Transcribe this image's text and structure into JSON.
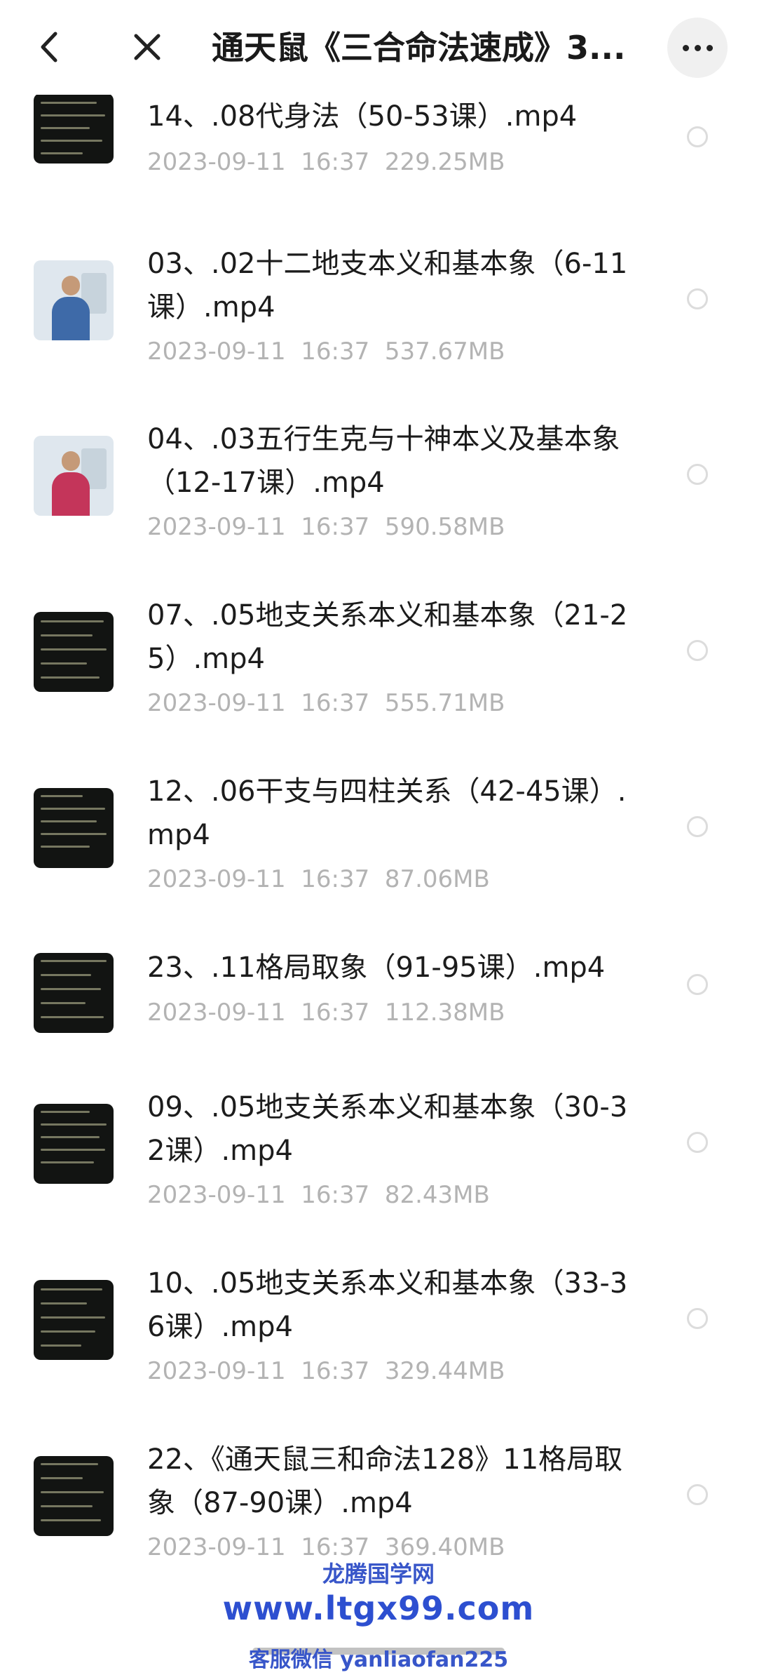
{
  "header": {
    "title": "通天鼠《三合命法速成》3...",
    "back_icon": "chevron-left-icon",
    "close_icon": "close-icon",
    "more_icon": "more-horizontal-icon"
  },
  "files": [
    {
      "name": "14、.08代身法（50-53课）.mp4",
      "date": "2023-09-11",
      "time": "16:37",
      "size": "229.25MB",
      "thumb": "text-slide"
    },
    {
      "name": "03、.02十二地支本义和基本象（6-11课）.mp4",
      "date": "2023-09-11",
      "time": "16:37",
      "size": "537.67MB",
      "thumb": "presenter-blue"
    },
    {
      "name": "04、.03五行生克与十神本义及基本象（12-17课）.mp4",
      "date": "2023-09-11",
      "time": "16:37",
      "size": "590.58MB",
      "thumb": "presenter-red"
    },
    {
      "name": "07、.05地支关系本义和基本象（21-25）.mp4",
      "date": "2023-09-11",
      "time": "16:37",
      "size": "555.71MB",
      "thumb": "text-slide"
    },
    {
      "name": "12、.06干支与四柱关系（42-45课）.mp4",
      "date": "2023-09-11",
      "time": "16:37",
      "size": "87.06MB",
      "thumb": "text-slide"
    },
    {
      "name": "23、.11格局取象（91-95课）.mp4",
      "date": "2023-09-11",
      "time": "16:37",
      "size": "112.38MB",
      "thumb": "text-slide"
    },
    {
      "name": "09、.05地支关系本义和基本象（30-32课）.mp4",
      "date": "2023-09-11",
      "time": "16:37",
      "size": "82.43MB",
      "thumb": "text-slide"
    },
    {
      "name": "10、.05地支关系本义和基本象（33-36课）.mp4",
      "date": "2023-09-11",
      "time": "16:37",
      "size": "329.44MB",
      "thumb": "text-slide"
    },
    {
      "name": "22、《通天鼠三和命法128》11格局取象（87-90课）.mp4",
      "date": "2023-09-11",
      "time": "16:37",
      "size": "369.40MB",
      "thumb": "text-slide"
    }
  ],
  "watermark": {
    "line1": "龙腾国学网",
    "line2": "www.ltgx99.com",
    "line3": "客服微信 yanliaofan225"
  },
  "colors": {
    "accent": "#2d4fd0",
    "meta_text": "#b3b3b3",
    "title_text": "#1a1a1a"
  }
}
